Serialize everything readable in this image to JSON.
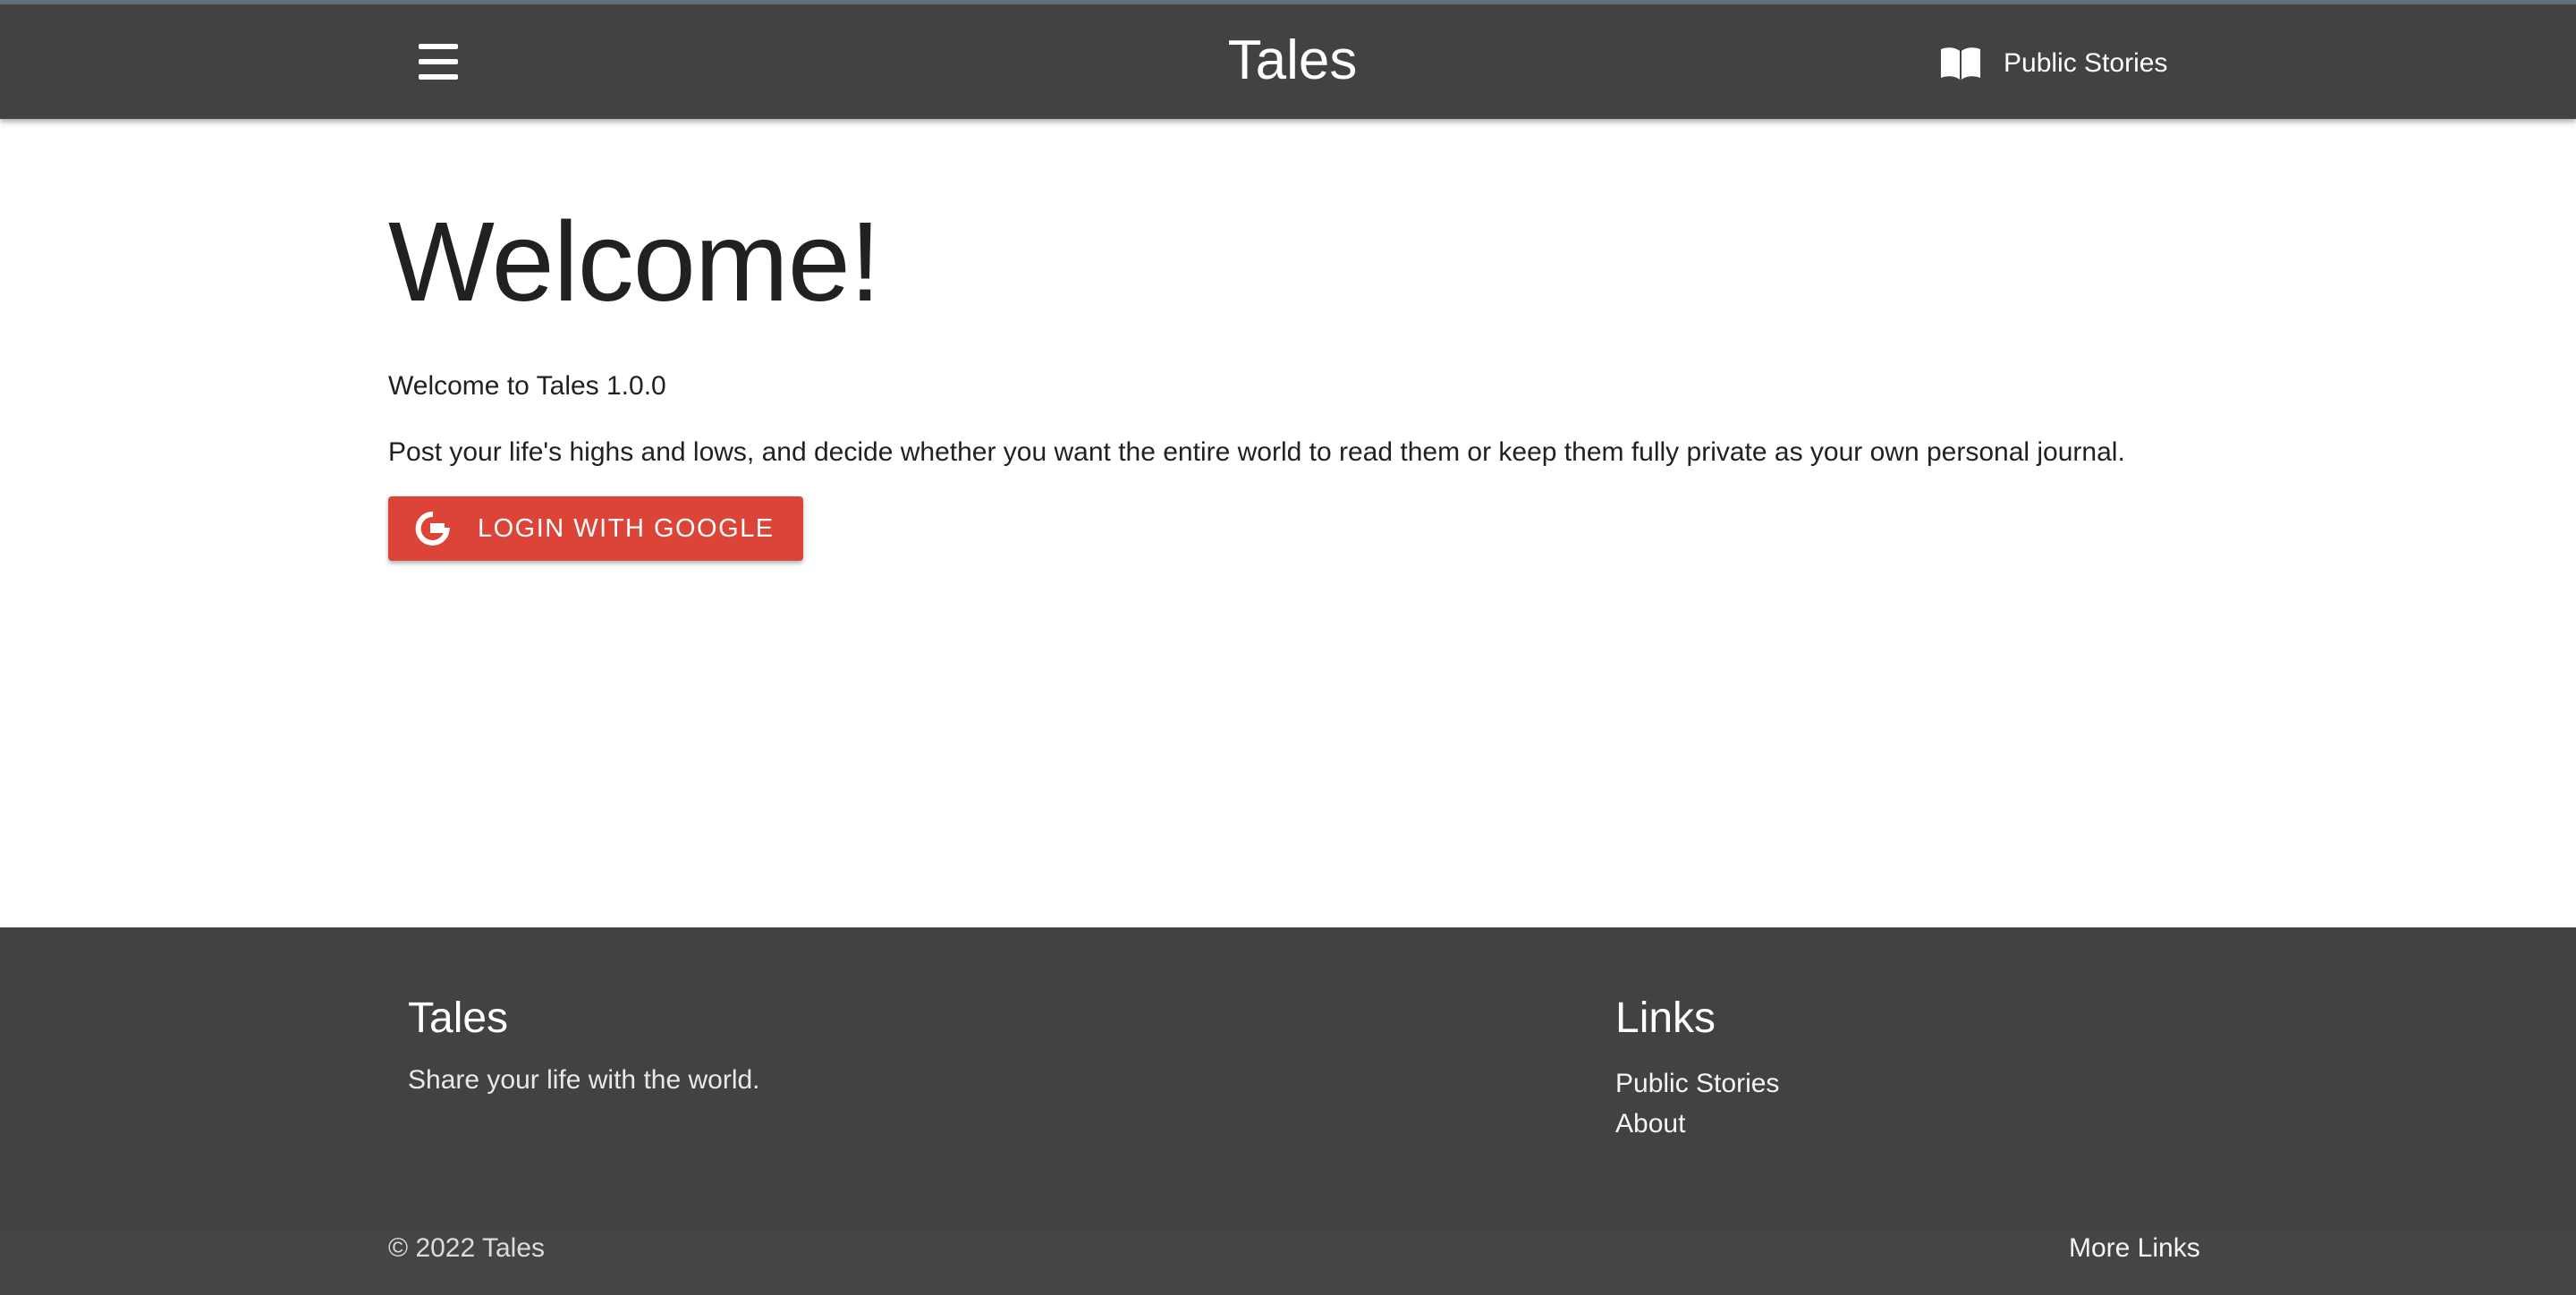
{
  "navbar": {
    "brand": "Tales",
    "menu_icon": "hamburger-menu-icon",
    "public_stories_icon": "open-book-icon",
    "public_stories_label": "Public Stories"
  },
  "main": {
    "heading": "Welcome!",
    "subtitle": "Welcome to Tales 1.0.0",
    "description": "Post your life's highs and lows, and decide whether you want the entire world to read them or keep them fully private as your own personal journal.",
    "login_button": {
      "icon": "google-g-icon",
      "label": "LOGIN WITH GOOGLE",
      "color": "#db4437"
    }
  },
  "footer": {
    "left": {
      "title": "Tales",
      "tagline": "Share your life with the world."
    },
    "right": {
      "title": "Links",
      "links": [
        {
          "label": "Public Stories"
        },
        {
          "label": "About"
        }
      ]
    },
    "copyright": "© 2022 Tales",
    "more_links": "More Links"
  },
  "colors": {
    "navbar_bg": "#424242",
    "footer_bg": "#424242",
    "button_red": "#db4437"
  }
}
